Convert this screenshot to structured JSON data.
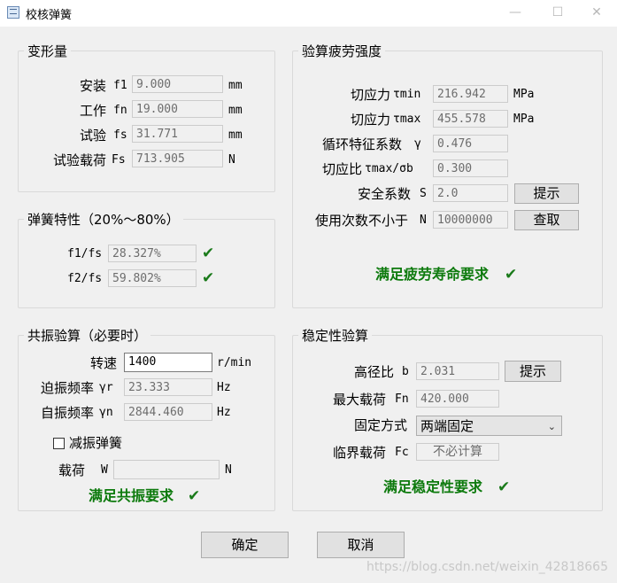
{
  "window": {
    "title": "校核弹簧",
    "minimize_glyph": "—",
    "maximize_glyph": "☐",
    "close_glyph": "✕"
  },
  "deformation": {
    "legend": "变形量",
    "rows": [
      {
        "label": "安装",
        "sym": "f1",
        "value": "9.000",
        "unit": "mm"
      },
      {
        "label": "工作",
        "sym": "fn",
        "value": "19.000",
        "unit": "mm"
      },
      {
        "label": "试验",
        "sym": "fs",
        "value": "31.771",
        "unit": "mm"
      },
      {
        "label": "试验载荷",
        "sym": "Fs",
        "value": "713.905",
        "unit": "N"
      }
    ]
  },
  "characteristics": {
    "legend": "弹簧特性（20%～80%）",
    "rows": [
      {
        "label": "f1/fs",
        "value": "28.327%",
        "check": "✔"
      },
      {
        "label": "f2/fs",
        "value": "59.802%",
        "check": "✔"
      }
    ]
  },
  "fatigue": {
    "legend": "验算疲劳强度",
    "rows": [
      {
        "label": "切应力",
        "sym": "τmin",
        "value": "216.942",
        "unit": "MPa"
      },
      {
        "label": "切应力",
        "sym": "τmax",
        "value": "455.578",
        "unit": "MPa"
      },
      {
        "label": "循环特征系数",
        "sym": "γ",
        "value": "0.476"
      },
      {
        "label": "切应比",
        "sym": "τmax/σb",
        "value": "0.300"
      },
      {
        "label": "安全系数",
        "sym": "S",
        "value": "2.0",
        "button": "提示"
      },
      {
        "label": "使用次数不小于",
        "sym": "N",
        "value": "10000000",
        "button": "查取"
      }
    ],
    "status": "满足疲劳寿命要求",
    "check": "✔"
  },
  "resonance": {
    "legend": "共振验算（必要时）",
    "speed_label": "转速",
    "speed_value": "1400",
    "speed_unit": "r/min",
    "forced_label": "迫振频率",
    "forced_sym": "γr",
    "forced_value": "23.333",
    "forced_unit": "Hz",
    "natural_label": "自振频率",
    "natural_sym": "γn",
    "natural_value": "2844.460",
    "natural_unit": "Hz",
    "damping_label": "减振弹簧",
    "load_label": "载荷",
    "load_sym": "W",
    "load_value": "",
    "load_unit": "N",
    "status": "满足共振要求",
    "check": "✔"
  },
  "stability": {
    "legend": "稳定性验算",
    "ratio_label": "高径比",
    "ratio_sym": "b",
    "ratio_value": "2.031",
    "ratio_button": "提示",
    "maxload_label": "最大载荷",
    "maxload_sym": "Fn",
    "maxload_value": "420.000",
    "fix_label": "固定方式",
    "fix_value": "两端固定",
    "critical_label": "临界载荷",
    "critical_sym": "Fc",
    "critical_value": "不必计算",
    "status": "满足稳定性要求",
    "check": "✔"
  },
  "footer": {
    "ok": "确定",
    "cancel": "取消",
    "watermark": "https://blog.csdn.net/weixin_42818665"
  }
}
